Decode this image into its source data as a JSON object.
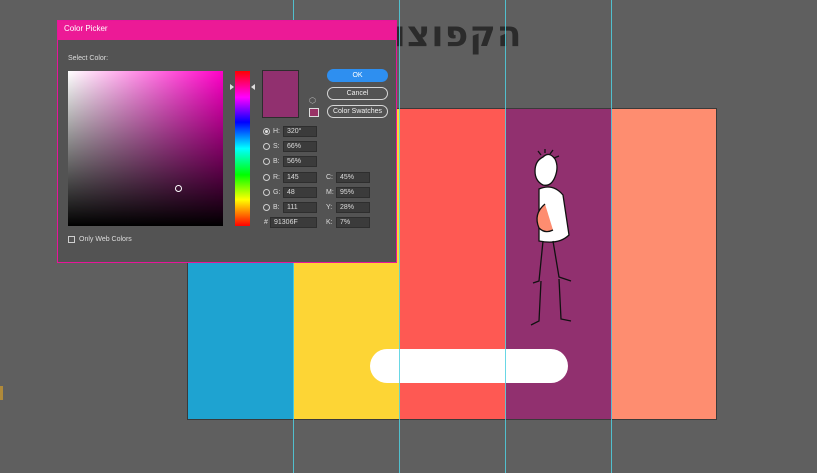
{
  "canvas": {
    "heading": "הקפוצון",
    "stripe_colors": [
      "#1ea3d1",
      "#fdd535",
      "#fe5953",
      "#91306f",
      "#fe8d70"
    ]
  },
  "color_picker": {
    "title": "Color Picker",
    "select_color_label": "Select Color:",
    "current_color": "#91306f",
    "websafe_color": "#993366",
    "buttons": {
      "ok": "OK",
      "cancel": "Cancel",
      "swatches": "Color Swatches"
    },
    "hsb": [
      {
        "label": "H:",
        "value": "320°",
        "selected": true
      },
      {
        "label": "S:",
        "value": "66%",
        "selected": false
      },
      {
        "label": "B:",
        "value": "56%",
        "selected": false
      }
    ],
    "rgb": [
      {
        "label": "R:",
        "value": "145"
      },
      {
        "label": "G:",
        "value": "48"
      },
      {
        "label": "B:",
        "value": "111"
      }
    ],
    "cmyk": [
      {
        "label": "C:",
        "value": "45%"
      },
      {
        "label": "M:",
        "value": "95%"
      },
      {
        "label": "Y:",
        "value": "28%"
      },
      {
        "label": "K:",
        "value": "7%"
      }
    ],
    "hex_label": "#",
    "hex_value": "91306F",
    "web_only_label": "Only Web Colors",
    "web_only_checked": false
  }
}
